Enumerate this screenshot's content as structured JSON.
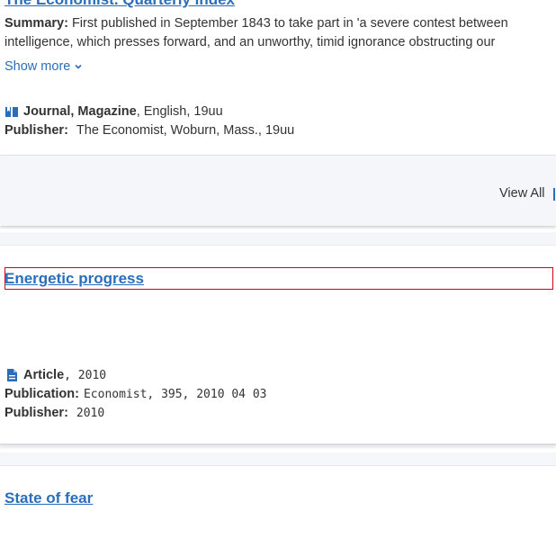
{
  "record1": {
    "title": "The Economist. Quarterly index",
    "summary_label": "Summary:",
    "summary_text": "First published in September 1843 to take part in 'a severe contest between intelligence, which presses forward, and an unworthy, timid ignorance obstructing our",
    "show_more": "Show more",
    "format": "Journal, Magazine",
    "format_rest": ", English, 19uu",
    "publisher_label": "Publisher:",
    "publisher_value": "The Economist, Woburn, Mass., 19uu"
  },
  "footer": {
    "view_all": "View All"
  },
  "record2": {
    "title": "Energetic progress",
    "format": "Article",
    "year": ", 2010",
    "publication_label": "Publication:",
    "publication_value": "Economist, 395, 2010 04 03",
    "publisher_label": "Publisher:",
    "publisher_value": "2010"
  },
  "record3": {
    "title": "State of fear"
  },
  "colors": {
    "link": "#2a6ebb",
    "highlight_border": "#d0021b",
    "band": "#f4f6f9"
  },
  "icons": {
    "journal": "open-book-icon",
    "article": "document-icon",
    "expand": "chevron-down-icon"
  }
}
